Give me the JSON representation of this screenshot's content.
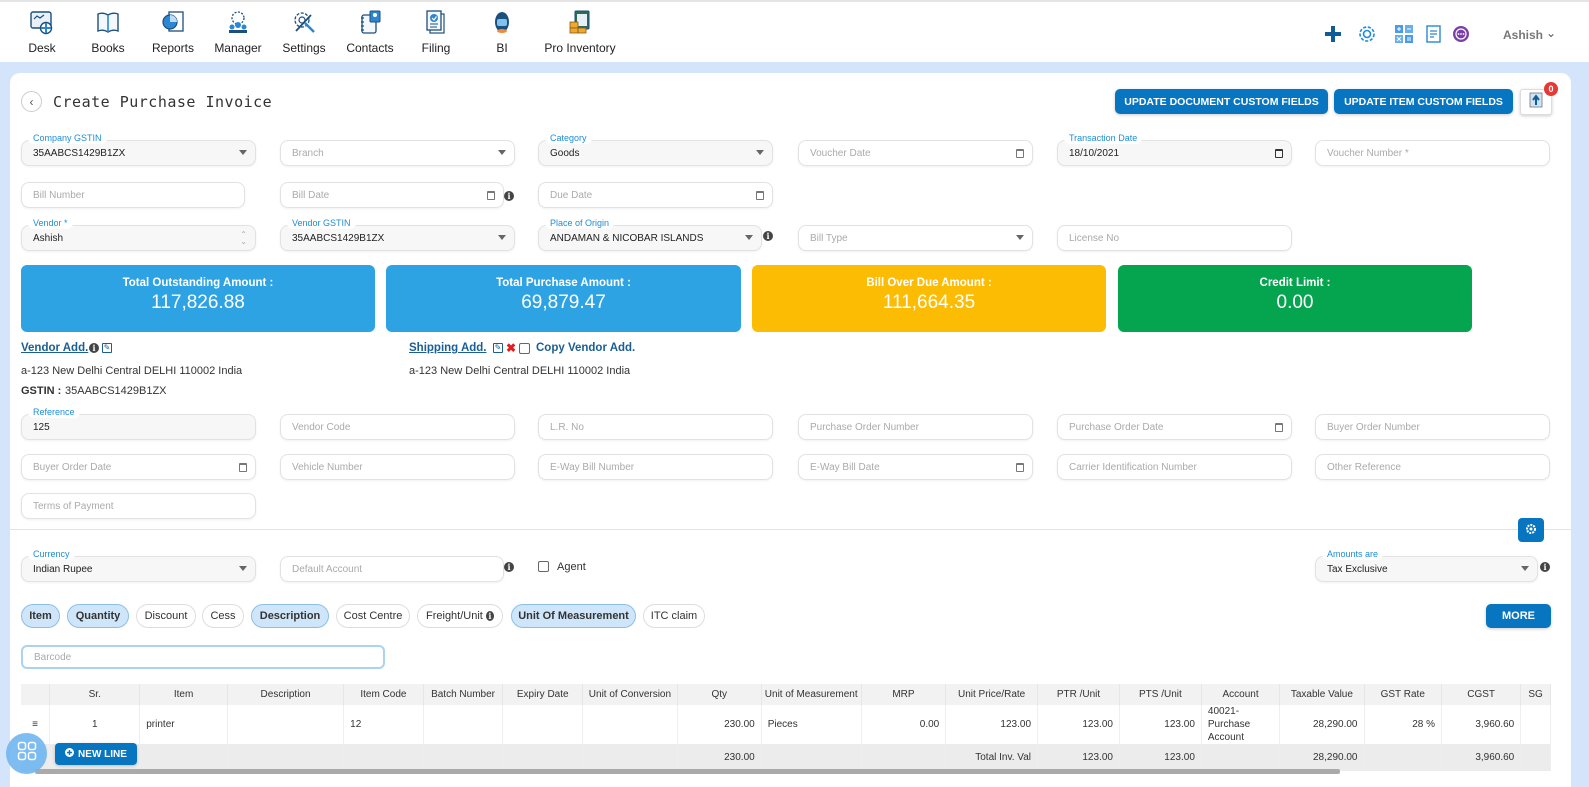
{
  "nav": {
    "items": [
      {
        "label": "Desk",
        "icon": "desk-icon"
      },
      {
        "label": "Books",
        "icon": "books-icon"
      },
      {
        "label": "Reports",
        "icon": "reports-icon"
      },
      {
        "label": "Manager",
        "icon": "manager-icon"
      },
      {
        "label": "Settings",
        "icon": "settings-icon"
      },
      {
        "label": "Contacts",
        "icon": "contacts-icon"
      },
      {
        "label": "Filing",
        "icon": "filing-icon"
      },
      {
        "label": "BI",
        "icon": "bi-icon"
      },
      {
        "label": "Pro Inventory",
        "icon": "pro-inventory-icon"
      }
    ],
    "user": "Ashish"
  },
  "header": {
    "title": "Create Purchase Invoice",
    "update_doc_fields": "UPDATE DOCUMENT CUSTOM FIELDS",
    "update_item_fields": "UPDATE ITEM CUSTOM FIELDS",
    "upload_badge": "0"
  },
  "form": {
    "company_gstin": {
      "label": "Company GSTIN",
      "value": "35AABCS1429B1ZX"
    },
    "branch": {
      "placeholder": "Branch"
    },
    "category": {
      "label": "Category",
      "value": "Goods"
    },
    "voucher_date": {
      "placeholder": "Voucher Date"
    },
    "transaction_date": {
      "label": "Transaction Date",
      "value": "18/10/2021"
    },
    "voucher_number": {
      "placeholder": "Voucher Number *"
    },
    "bill_number": {
      "placeholder": "Bill Number"
    },
    "bill_date": {
      "placeholder": "Bill Date"
    },
    "due_date": {
      "placeholder": "Due Date"
    },
    "vendor": {
      "label": "Vendor *",
      "value": "Ashish"
    },
    "vendor_gstin": {
      "label": "Vendor GSTIN",
      "value": "35AABCS1429B1ZX"
    },
    "place_of_origin": {
      "label": "Place of Origin",
      "value": "ANDAMAN & NICOBAR ISLANDS"
    },
    "bill_type": {
      "placeholder": "Bill Type"
    },
    "license_no": {
      "placeholder": "License No"
    }
  },
  "cards": [
    {
      "title": "Total Outstanding Amount :",
      "value": "117,826.88",
      "color": "#2ea3e3"
    },
    {
      "title": "Total Purchase Amount :",
      "value": "69,879.47",
      "color": "#2ea3e3"
    },
    {
      "title": "Bill Over Due Amount :",
      "value": "111,664.35",
      "color": "#fcbc04"
    },
    {
      "title": "Credit Limit :",
      "value": "0.00",
      "color": "#05a54f"
    }
  ],
  "address": {
    "vendor_link": "Vendor Add.",
    "vendor_address": "a-123 New Delhi Central DELHI 110002 India",
    "gstin_label": "GSTIN :",
    "gstin_value": "35AABCS1429B1ZX",
    "shipping_link": "Shipping Add.",
    "copy_vendor": "Copy Vendor Add.",
    "shipping_address": "a-123 New Delhi Central DELHI 110002 India"
  },
  "extra": {
    "reference": {
      "label": "Reference",
      "value": "125"
    },
    "vendor_code": "Vendor Code",
    "lr_no": "L.R. No",
    "po_number": "Purchase Order Number",
    "po_date": "Purchase Order Date",
    "buyer_order_number": "Buyer Order Number",
    "buyer_order_date": "Buyer Order Date",
    "vehicle_number": "Vehicle Number",
    "eway_bill_number": "E-Way Bill Number",
    "eway_bill_date": "E-Way Bill Date",
    "carrier_id": "Carrier Identification Number",
    "other_reference": "Other Reference",
    "terms_of_payment": "Terms of Payment"
  },
  "settings": {
    "currency": {
      "label": "Currency",
      "value": "Indian Rupee"
    },
    "default_account": "Default Account",
    "agent": "Agent",
    "amounts_are": {
      "label": "Amounts are",
      "value": "Tax Exclusive"
    }
  },
  "chips": [
    {
      "label": "Item",
      "active": true
    },
    {
      "label": "Quantity",
      "active": true
    },
    {
      "label": "Discount",
      "active": false
    },
    {
      "label": "Cess",
      "active": false
    },
    {
      "label": "Description",
      "active": true
    },
    {
      "label": "Cost Centre",
      "active": false
    },
    {
      "label": "Freight/Unit",
      "active": false
    },
    {
      "label": "Unit Of Measurement",
      "active": true
    },
    {
      "label": "ITC claim",
      "active": false
    }
  ],
  "more_label": "MORE",
  "barcode_placeholder": "Barcode",
  "table": {
    "columns": [
      "",
      "Sr.",
      "Item",
      "Description",
      "Item Code",
      "Batch Number",
      "Expiry Date",
      "Unit of Conversion",
      "Qty",
      "Unit of Measurement",
      "MRP",
      "Unit Price/Rate",
      "PTR /Unit",
      "PTS /Unit",
      "Account",
      "Taxable Value",
      "GST Rate",
      "CGST",
      "SG"
    ],
    "rows": [
      [
        "≡",
        "1",
        "printer",
        "",
        "12",
        "",
        "",
        "",
        "230.00",
        "Pieces",
        "0.00",
        "123.00",
        "123.00",
        "123.00",
        "40021-Purchase Account",
        "28,290.00",
        "28 %",
        "3,960.60",
        ""
      ]
    ],
    "totals": [
      "",
      "",
      "",
      "",
      "",
      "",
      "",
      "",
      "230.00",
      "",
      "",
      "Total Inv. Val",
      "123.00",
      "123.00",
      "",
      "28,290.00",
      "",
      "3,960.60",
      ""
    ]
  },
  "new_line": "NEW LINE"
}
